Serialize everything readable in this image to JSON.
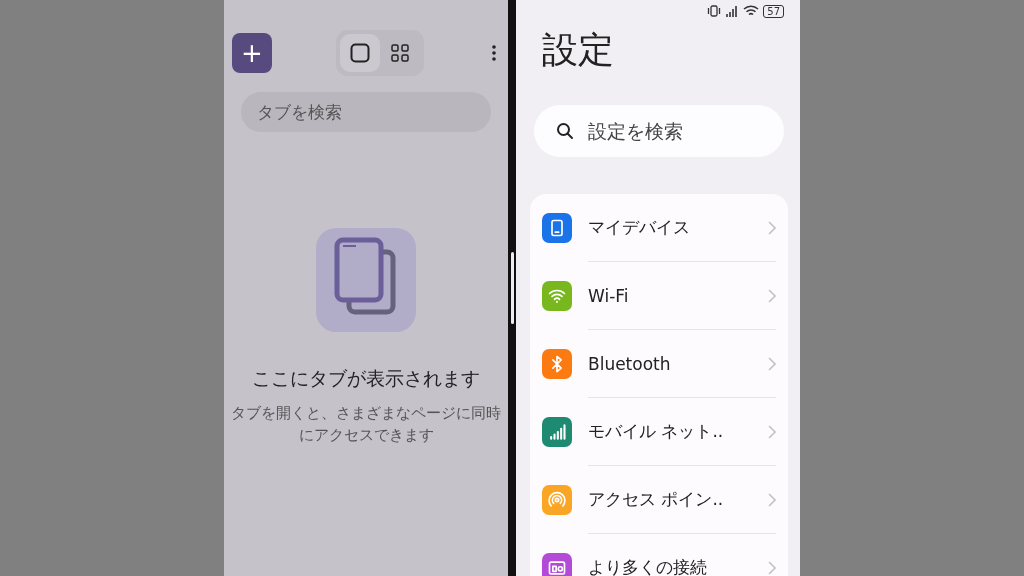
{
  "tabs_pane": {
    "new_tab_button": "+",
    "view_toggles": [
      {
        "kind": "single",
        "selected": true
      },
      {
        "kind": "grid",
        "selected": false
      }
    ],
    "search": {
      "placeholder": "タブを検索"
    },
    "empty_state": {
      "title": "ここにタブが表示されます",
      "message": "タブを開くと、さまざまなページに同時にアクセスできます"
    }
  },
  "settings_pane": {
    "status_bar": {
      "battery": "57"
    },
    "title": "設定",
    "search": {
      "placeholder": "設定を検索"
    },
    "items": [
      {
        "label": "マイデバイス",
        "kind": "phone",
        "color": "#1a73e8"
      },
      {
        "label": "Wi-Fi",
        "kind": "wifi",
        "color": "#78b81e"
      },
      {
        "label": "Bluetooth",
        "kind": "bluetooth",
        "color": "#fb7a12"
      },
      {
        "label": "モバイル ネット..",
        "kind": "signal",
        "color": "#1e8a72"
      },
      {
        "label": "アクセス ポイン..",
        "kind": "hotspot",
        "color": "#fba524"
      },
      {
        "label": "より多くの接続",
        "kind": "connect",
        "color": "#b44ad8"
      }
    ]
  }
}
